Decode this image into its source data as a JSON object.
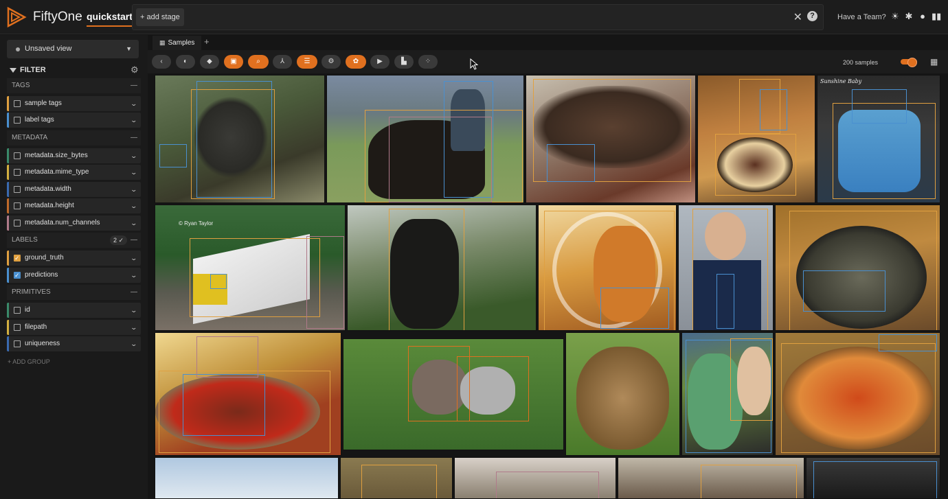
{
  "header": {
    "brand": "FiftyOne",
    "dataset": "quickstart",
    "add_stage": "+ add stage",
    "team": "Have a Team?",
    "icons": [
      "clear-icon",
      "help-icon",
      "sun-icon",
      "slack-icon",
      "github-icon",
      "docs-icon"
    ]
  },
  "sidebar": {
    "view": "Unsaved view",
    "filter_title": "FILTER",
    "groups": {
      "tags": "TAGS",
      "metadata": "METADATA",
      "labels": "LABELS",
      "labels_count": "2 ✓",
      "primitives": "PRIMITIVES"
    },
    "fields": {
      "sample_tags": "sample tags",
      "label_tags": "label tags",
      "size_bytes": "metadata.size_bytes",
      "mime_type": "metadata.mime_type",
      "width": "metadata.width",
      "height": "metadata.height",
      "num_channels": "metadata.num_channels",
      "ground_truth": "ground_truth",
      "predictions": "predictions",
      "id": "id",
      "filepath": "filepath",
      "uniqueness": "uniqueness"
    },
    "add_group": "+ ADD GROUP"
  },
  "tabs": {
    "samples": "Samples",
    "add": "+"
  },
  "toolbar": {
    "samples_count": "200 samples"
  },
  "images": {
    "train_caption": "© Ryan Taylor",
    "cake_caption": "Sunshine Baby"
  },
  "colors": {
    "accent": "#e0701f",
    "ground_truth": "#e0a040",
    "predictions": "#4a90d0"
  }
}
